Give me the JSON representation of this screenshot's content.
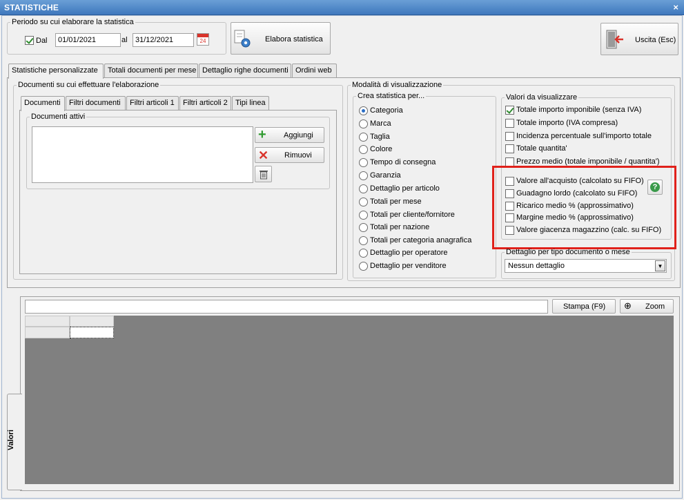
{
  "window": {
    "title": "STATISTICHE",
    "close_symbol": "×"
  },
  "periodo": {
    "legend": "Periodo su cui elaborare la statistica",
    "dal_label": "Dal",
    "dal_checked": true,
    "date_from": "01/01/2021",
    "al_label": "al",
    "date_to": "31/12/2021",
    "calendar_day": "24"
  },
  "buttons": {
    "elabora": "Elabora statistica",
    "uscita": "Uscita (Esc)"
  },
  "main_tabs": [
    {
      "label": "Statistiche personalizzate",
      "active": true
    },
    {
      "label": "Totali documenti per mese"
    },
    {
      "label": "Dettaglio righe documenti"
    },
    {
      "label": "Ordini web"
    }
  ],
  "documenti_group": {
    "legend": "Documenti su cui effettuare l'elaborazione",
    "tabs": [
      "Documenti",
      "Filtri documenti",
      "Filtri articoli 1",
      "Filtri articoli 2",
      "Tipi linea"
    ],
    "attivi_legend": "Documenti attivi",
    "aggiungi": "Aggiungi",
    "rimuovi": "Rimuovi"
  },
  "modalita": {
    "legend": "Modalità di visualizzazione",
    "crea_legend": "Crea statistica per...",
    "options": [
      "Categoria",
      "Marca",
      "Taglia",
      "Colore",
      "Tempo di consegna",
      "Garanzia",
      "Dettaglio per articolo",
      "Totali per mese",
      "Totali per cliente/fornitore",
      "Totali per nazione",
      "Totali per categoria anagrafica",
      "Dettaglio per operatore",
      "Dettaglio per venditore"
    ],
    "selected": 0,
    "valori_legend": "Valori da visualizzare",
    "valori": [
      {
        "label": "Totale importo imponibile (senza IVA)",
        "checked": true
      },
      {
        "label": "Totale importo (IVA compresa)",
        "checked": false
      },
      {
        "label": "Incidenza percentuale sull'importo totale",
        "checked": false
      },
      {
        "label": "Totale quantita'",
        "checked": false
      },
      {
        "label": "Prezzo medio (totale imponibile / quantita')",
        "checked": false
      },
      {
        "label": "Valore all'acquisto (calcolato su FIFO)",
        "checked": false
      },
      {
        "label": "Guadagno lordo (calcolato su FIFO)",
        "checked": false
      },
      {
        "label": "Ricarico medio % (approssimativo)",
        "checked": false
      },
      {
        "label": "Margine medio % (approssimativo)",
        "checked": false
      },
      {
        "label": "Valore giacenza magazzino (calc. su FIFO)",
        "checked": false
      }
    ],
    "help_symbol": "?",
    "dettaglio_legend": "Dettaglio per tipo documento o mese",
    "dettaglio_value": "Nessun dettaglio"
  },
  "results": {
    "side_tab": "Valori",
    "stampa": "Stampa (F9)",
    "zoom": "Zoom",
    "colors": {
      "grid_bg": "#808080",
      "highlight": "#e0211b"
    }
  }
}
